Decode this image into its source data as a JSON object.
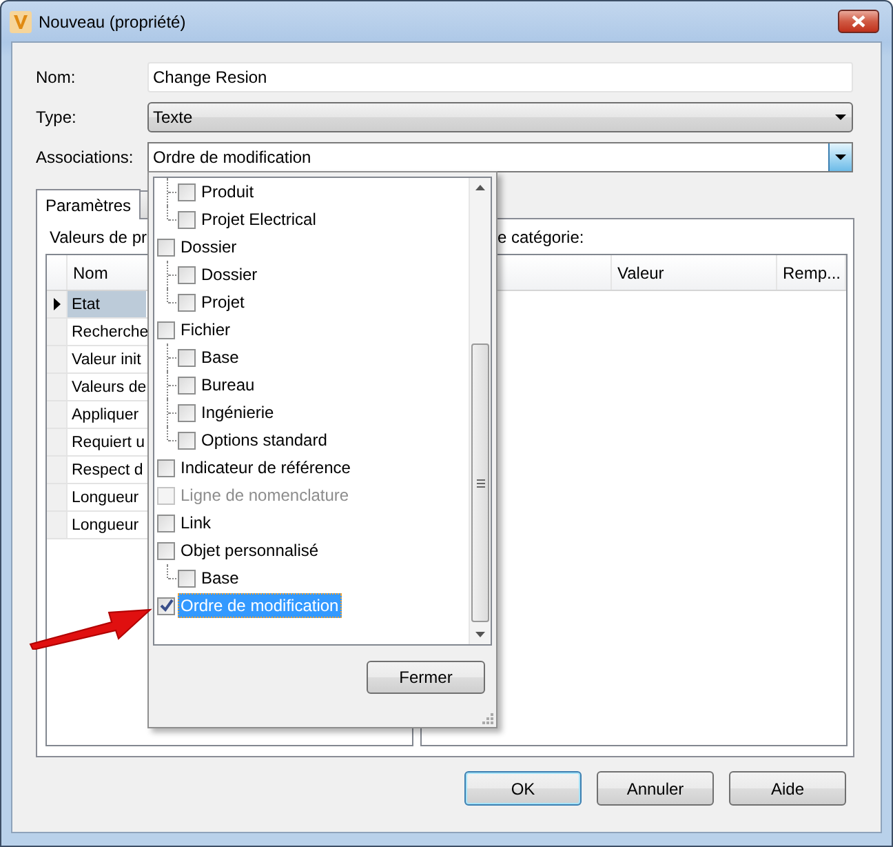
{
  "window": {
    "title": "Nouveau (propriété)"
  },
  "fields": [
    {
      "label": "Nom:",
      "kind": "text",
      "value": "Change Resion"
    },
    {
      "label": "Type:",
      "kind": "select",
      "value": "Texte"
    },
    {
      "label": "Associations:",
      "kind": "dropdown",
      "value": "Ordre de modification",
      "open": true
    }
  ],
  "tabs": [
    {
      "label": "Paramètres",
      "selected": true
    },
    {
      "selected": false
    }
  ],
  "left_panel": {
    "label": "Valeurs de pr",
    "columns": [
      "Nom"
    ],
    "rows": [
      {
        "cells": [
          "Etat"
        ],
        "selected": true
      },
      {
        "cells": [
          "Recherche"
        ],
        "selected": false
      },
      {
        "cells": [
          "Valeur init"
        ],
        "selected": false
      },
      {
        "cells": [
          "Valeurs de"
        ],
        "selected": false
      },
      {
        "cells": [
          "Appliquer"
        ],
        "selected": false
      },
      {
        "cells": [
          "Requiert u"
        ],
        "selected": false
      },
      {
        "cells": [
          "Respect d"
        ],
        "selected": false
      },
      {
        "cells": [
          "Longueur"
        ],
        "selected": false
      },
      {
        "cells": [
          "Longueur"
        ],
        "selected": false
      }
    ]
  },
  "right_panel": {
    "label": "e catégorie:",
    "columns": [
      "Valeur",
      "Remp..."
    ]
  },
  "popup": {
    "items": [
      {
        "children": [
          {
            "label": "Produit",
            "checked": false,
            "disabled": false,
            "selected": false
          },
          {
            "label": "Projet Electrical",
            "checked": false,
            "disabled": false,
            "selected": false
          }
        ]
      },
      {
        "label": "Dossier",
        "checked": false,
        "disabled": false,
        "selected": false,
        "children": [
          {
            "label": "Dossier",
            "checked": false,
            "disabled": false,
            "selected": false
          },
          {
            "label": "Projet",
            "checked": false,
            "disabled": false,
            "selected": false
          }
        ]
      },
      {
        "label": "Fichier",
        "checked": false,
        "disabled": false,
        "selected": false,
        "children": [
          {
            "label": "Base",
            "checked": false,
            "disabled": false,
            "selected": false
          },
          {
            "label": "Bureau",
            "checked": false,
            "disabled": false,
            "selected": false
          },
          {
            "label": "Ingénierie",
            "checked": false,
            "disabled": false,
            "selected": false
          },
          {
            "label": "Options standard",
            "checked": false,
            "disabled": false,
            "selected": false
          }
        ]
      },
      {
        "label": "Indicateur de référence",
        "checked": false,
        "disabled": false,
        "selected": false
      },
      {
        "label": "Ligne de nomenclature",
        "checked": false,
        "disabled": true,
        "selected": false
      },
      {
        "label": "Link",
        "checked": false,
        "disabled": false,
        "selected": false
      },
      {
        "label": "Objet personnalisé",
        "checked": false,
        "disabled": false,
        "selected": false,
        "children": [
          {
            "label": "Base",
            "checked": false,
            "disabled": false,
            "selected": false
          }
        ]
      },
      {
        "label": "Ordre de modification",
        "checked": true,
        "disabled": false,
        "selected": true
      }
    ],
    "button": "Fermer"
  },
  "buttons": [
    {
      "label": "OK",
      "default": true
    },
    {
      "label": "Annuler",
      "default": false
    },
    {
      "label": "Aide",
      "default": false
    }
  ]
}
